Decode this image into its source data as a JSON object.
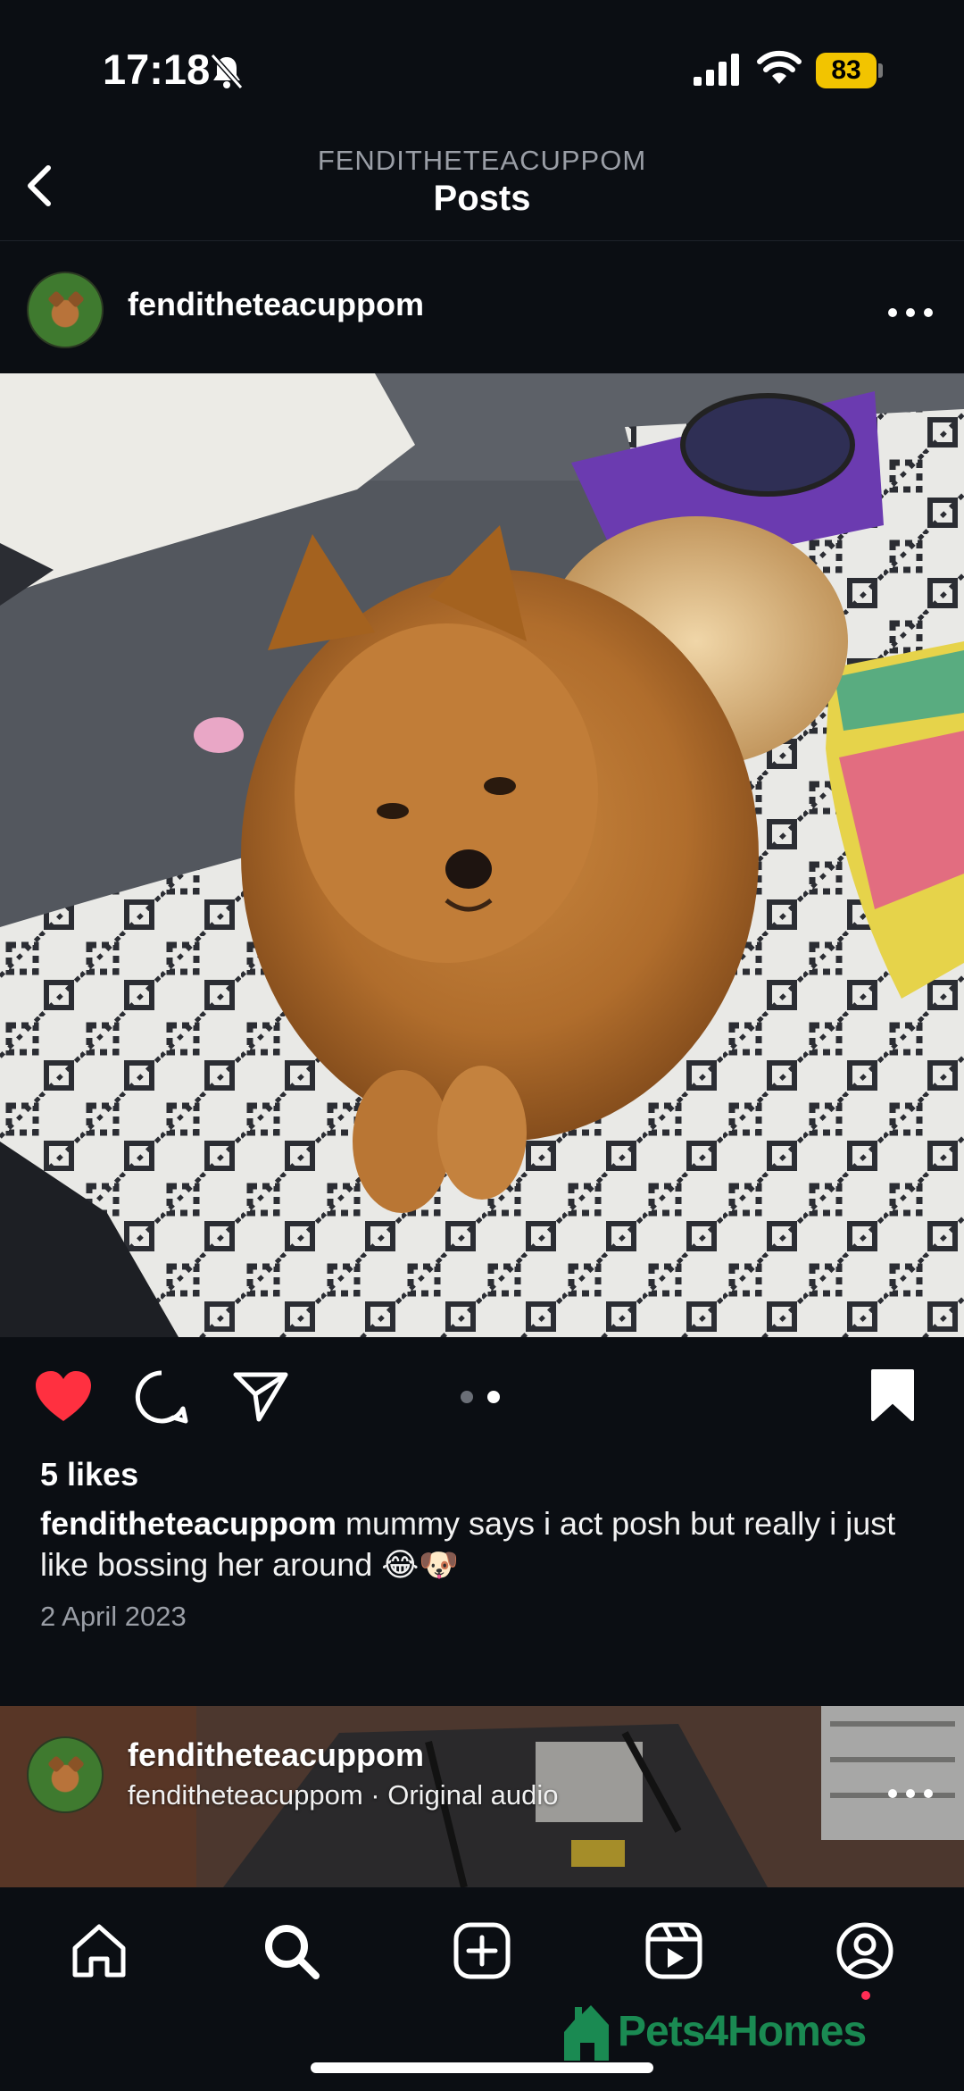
{
  "status_bar": {
    "time": "17:18",
    "battery": "83"
  },
  "header": {
    "account_handle": "FENDITHETEACUPPOM",
    "title": "Posts"
  },
  "post": {
    "username": "fenditheteacuppom",
    "likes": "5 likes",
    "caption_user": "fenditheteacuppom",
    "caption_text": "mummy says i act posh but really i just like bossing her around 😂🐶",
    "date": "2 April 2023",
    "liked": true,
    "saved": true,
    "carousel_index": 2,
    "carousel_count": 2
  },
  "next_post": {
    "username": "fenditheteacuppom",
    "audio": "fenditheteacuppom · Original audio"
  },
  "tab_bar": {
    "items": [
      "home-icon",
      "search-icon",
      "create-icon",
      "reels-icon",
      "profile-icon"
    ],
    "active": "search-icon"
  },
  "watermark": {
    "text": "Pets4Homes"
  },
  "colors": {
    "background": "#0b0e13",
    "like_red": "#ff3040",
    "watermark_green": "#1a8a52",
    "battery_yellow": "#f2c400"
  }
}
